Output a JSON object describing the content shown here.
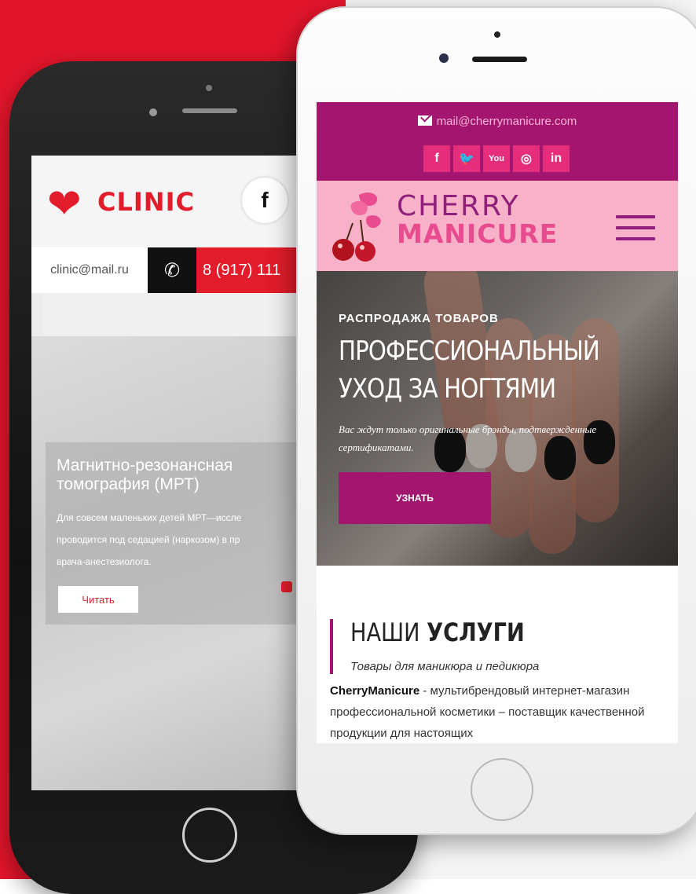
{
  "clinic": {
    "logo_text": "CLINIC",
    "social_fb": "f",
    "email": "clinic@mail.ru",
    "phone": "8 (917) 111",
    "slide_title": "Магнитно-резонансная томография (МРТ)",
    "slide_text_lines": [
      "Для совсем маленьких детей МРТ—иссле",
      "проводится под седацией (наркозом) в пр",
      "врача-анестезиолога."
    ],
    "read_button": "Читать"
  },
  "cherry": {
    "email": "mail@cherrymanicure.com",
    "social": [
      "f",
      "🐦",
      "You",
      "◎",
      "in"
    ],
    "logo_line1": "CHERRY",
    "logo_line2": "MANICURE",
    "hero": {
      "eyebrow": "РАСПРОДАЖА ТОВАРОВ",
      "title": "ПРОФЕССИОНАЛЬНЫЙ УХОД ЗА НОГТЯМИ",
      "lead": "Вас ждут только оригинальные брэнды, подтвержденные сертификатами.",
      "button": "УЗНАТЬ"
    },
    "services": {
      "title_light": "НАШИ",
      "title_bold": "УСЛУГИ",
      "subtitle": "Товары для маникюра и педикюра",
      "brand": "CherryManicure",
      "body": " - мультибрендовый интернет-магазин профессиональной косметики – поставщик качественной продукции для настоящих"
    }
  },
  "colors": {
    "background_red": "#e3152b",
    "clinic_red": "#e21c2a",
    "cherry_purple": "#a3166f",
    "cherry_pink": "#f7b1c8",
    "cherry_hot_pink": "#e52d7b"
  }
}
